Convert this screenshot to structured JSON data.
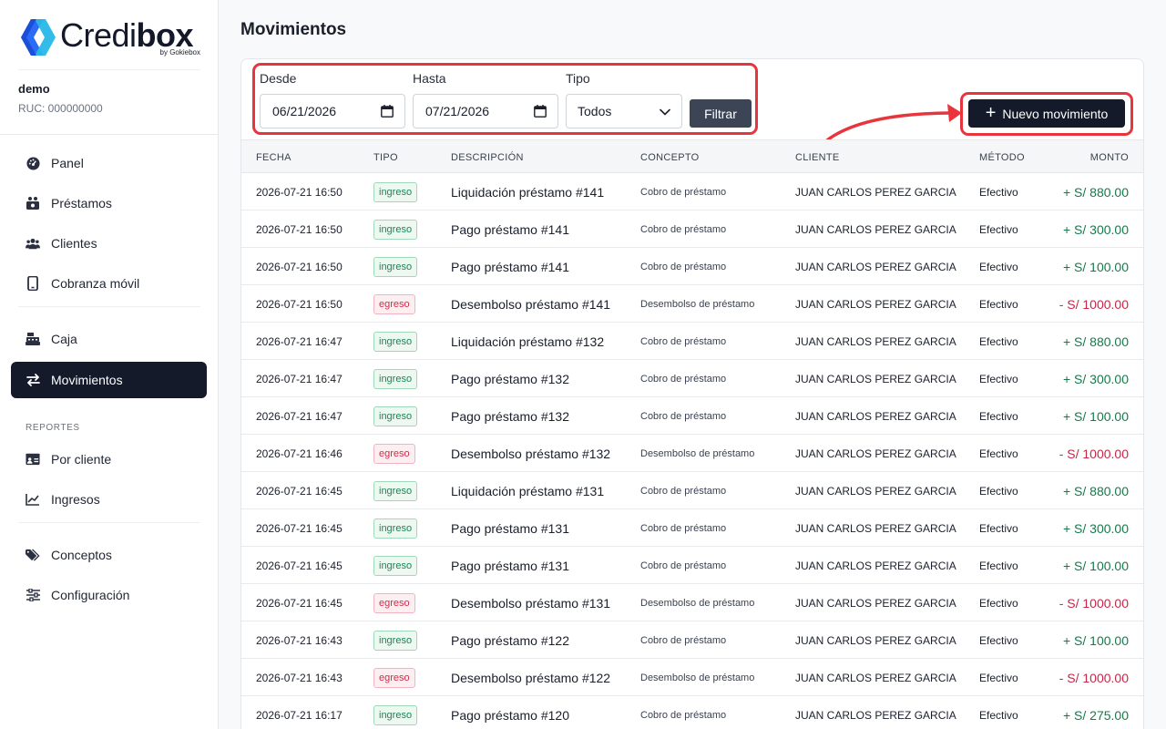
{
  "brand": {
    "name_part1": "Credi",
    "name_part2": "box",
    "byline": "by Gokiebox",
    "mark_color": "#1e6bff"
  },
  "company": {
    "name": "demo",
    "ruc": "RUC: 000000000"
  },
  "nav": {
    "panel": "Panel",
    "prestamos": "Préstamos",
    "clientes": "Clientes",
    "cobranza": "Cobranza móvil",
    "caja": "Caja",
    "movimientos": "Movimientos",
    "reportes_section": "REPORTES",
    "por_cliente": "Por cliente",
    "ingresos": "Ingresos",
    "conceptos": "Conceptos",
    "configuracion": "Configuración"
  },
  "page": {
    "title": "Movimientos"
  },
  "filters": {
    "desde_label": "Desde",
    "desde_value": "06/21/2026",
    "hasta_label": "Hasta",
    "hasta_value": "07/21/2026",
    "tipo_label": "Tipo",
    "tipo_value": "Todos",
    "filtrar_label": "Filtrar"
  },
  "actions": {
    "nuevo_label": "Nuevo movimiento"
  },
  "table": {
    "headers": {
      "fecha": "FECHA",
      "tipo": "TIPO",
      "descripcion": "DESCRIPCIÓN",
      "concepto": "CONCEPTO",
      "cliente": "CLIENTE",
      "metodo": "MÉTODO",
      "monto": "MONTO"
    },
    "rows": [
      {
        "fecha": "2026-07-21 16:50",
        "tipo": "ingreso",
        "descripcion": "Liquidación préstamo #141",
        "concepto": "Cobro de préstamo",
        "cliente": "JUAN CARLOS PEREZ GARCIA",
        "metodo": "Efectivo",
        "monto": "+ S/ 880.00"
      },
      {
        "fecha": "2026-07-21 16:50",
        "tipo": "ingreso",
        "descripcion": "Pago préstamo #141",
        "concepto": "Cobro de préstamo",
        "cliente": "JUAN CARLOS PEREZ GARCIA",
        "metodo": "Efectivo",
        "monto": "+ S/ 300.00"
      },
      {
        "fecha": "2026-07-21 16:50",
        "tipo": "ingreso",
        "descripcion": "Pago préstamo #141",
        "concepto": "Cobro de préstamo",
        "cliente": "JUAN CARLOS PEREZ GARCIA",
        "metodo": "Efectivo",
        "monto": "+ S/ 100.00"
      },
      {
        "fecha": "2026-07-21 16:50",
        "tipo": "egreso",
        "descripcion": "Desembolso préstamo #141",
        "concepto": "Desembolso de préstamo",
        "cliente": "JUAN CARLOS PEREZ GARCIA",
        "metodo": "Efectivo",
        "monto": "- S/ 1000.00"
      },
      {
        "fecha": "2026-07-21 16:47",
        "tipo": "ingreso",
        "descripcion": "Liquidación préstamo #132",
        "concepto": "Cobro de préstamo",
        "cliente": "JUAN CARLOS PEREZ GARCIA",
        "metodo": "Efectivo",
        "monto": "+ S/ 880.00"
      },
      {
        "fecha": "2026-07-21 16:47",
        "tipo": "ingreso",
        "descripcion": "Pago préstamo #132",
        "concepto": "Cobro de préstamo",
        "cliente": "JUAN CARLOS PEREZ GARCIA",
        "metodo": "Efectivo",
        "monto": "+ S/ 300.00"
      },
      {
        "fecha": "2026-07-21 16:47",
        "tipo": "ingreso",
        "descripcion": "Pago préstamo #132",
        "concepto": "Cobro de préstamo",
        "cliente": "JUAN CARLOS PEREZ GARCIA",
        "metodo": "Efectivo",
        "monto": "+ S/ 100.00"
      },
      {
        "fecha": "2026-07-21 16:46",
        "tipo": "egreso",
        "descripcion": "Desembolso préstamo #132",
        "concepto": "Desembolso de préstamo",
        "cliente": "JUAN CARLOS PEREZ GARCIA",
        "metodo": "Efectivo",
        "monto": "- S/ 1000.00"
      },
      {
        "fecha": "2026-07-21 16:45",
        "tipo": "ingreso",
        "descripcion": "Liquidación préstamo #131",
        "concepto": "Cobro de préstamo",
        "cliente": "JUAN CARLOS PEREZ GARCIA",
        "metodo": "Efectivo",
        "monto": "+ S/ 880.00"
      },
      {
        "fecha": "2026-07-21 16:45",
        "tipo": "ingreso",
        "descripcion": "Pago préstamo #131",
        "concepto": "Cobro de préstamo",
        "cliente": "JUAN CARLOS PEREZ GARCIA",
        "metodo": "Efectivo",
        "monto": "+ S/ 300.00"
      },
      {
        "fecha": "2026-07-21 16:45",
        "tipo": "ingreso",
        "descripcion": "Pago préstamo #131",
        "concepto": "Cobro de préstamo",
        "cliente": "JUAN CARLOS PEREZ GARCIA",
        "metodo": "Efectivo",
        "monto": "+ S/ 100.00"
      },
      {
        "fecha": "2026-07-21 16:45",
        "tipo": "egreso",
        "descripcion": "Desembolso préstamo #131",
        "concepto": "Desembolso de préstamo",
        "cliente": "JUAN CARLOS PEREZ GARCIA",
        "metodo": "Efectivo",
        "monto": "- S/ 1000.00"
      },
      {
        "fecha": "2026-07-21 16:43",
        "tipo": "ingreso",
        "descripcion": "Pago préstamo #122",
        "concepto": "Cobro de préstamo",
        "cliente": "JUAN CARLOS PEREZ GARCIA",
        "metodo": "Efectivo",
        "monto": "+ S/ 100.00"
      },
      {
        "fecha": "2026-07-21 16:43",
        "tipo": "egreso",
        "descripcion": "Desembolso préstamo #122",
        "concepto": "Desembolso de préstamo",
        "cliente": "JUAN CARLOS PEREZ GARCIA",
        "metodo": "Efectivo",
        "monto": "- S/ 1000.00"
      },
      {
        "fecha": "2026-07-21 16:17",
        "tipo": "ingreso",
        "descripcion": "Pago préstamo #120",
        "concepto": "Cobro de préstamo",
        "cliente": "JUAN CARLOS PEREZ GARCIA",
        "metodo": "Efectivo",
        "monto": "+ S/ 275.00"
      }
    ]
  },
  "colors": {
    "ingreso": "#157a4a",
    "egreso": "#c82647",
    "annotation": "#e8353d",
    "nav_active": "#141a2a"
  }
}
